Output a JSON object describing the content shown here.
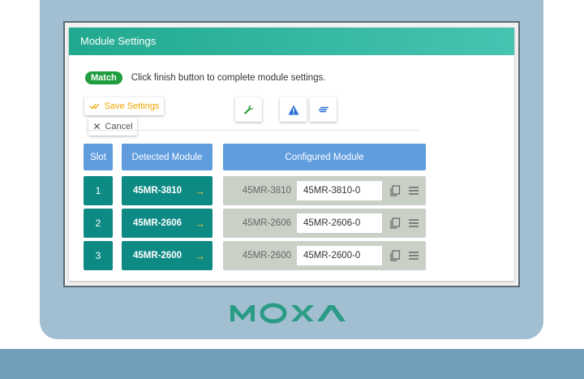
{
  "panel": {
    "title": "Module Settings"
  },
  "status": {
    "badge": "Match",
    "message": "Click finish button to complete module settings."
  },
  "toolbar": {
    "save_label": "Save Settings",
    "save_icon": "double-check-icon",
    "cancel_label": "Cancel",
    "cancel_icon": "close-icon",
    "icons": [
      "wrench-icon",
      "warning-icon",
      "lines-icon"
    ]
  },
  "table": {
    "headers": {
      "slot": "Slot",
      "detected": "Detected Module",
      "configured": "Configured Module"
    },
    "rows": [
      {
        "slot": "1",
        "detected": "45MR-3810",
        "configured_model": "45MR-3810",
        "configured_name": "45MR-3810-0"
      },
      {
        "slot": "2",
        "detected": "45MR-2606",
        "configured_model": "45MR-2606",
        "configured_name": "45MR-2606-0"
      },
      {
        "slot": "3",
        "detected": "45MR-2600",
        "configured_model": "45MR-2600",
        "configured_name": "45MR-2600-0"
      }
    ]
  },
  "brand": {
    "logo": "MOXA",
    "color": "#2a9b84"
  },
  "colors": {
    "header_teal": "#21a98f",
    "slot_teal": "#0e8a84",
    "table_header_blue": "#5f9ddf",
    "match_green": "#1f9e3f",
    "save_orange": "#f0a500"
  }
}
